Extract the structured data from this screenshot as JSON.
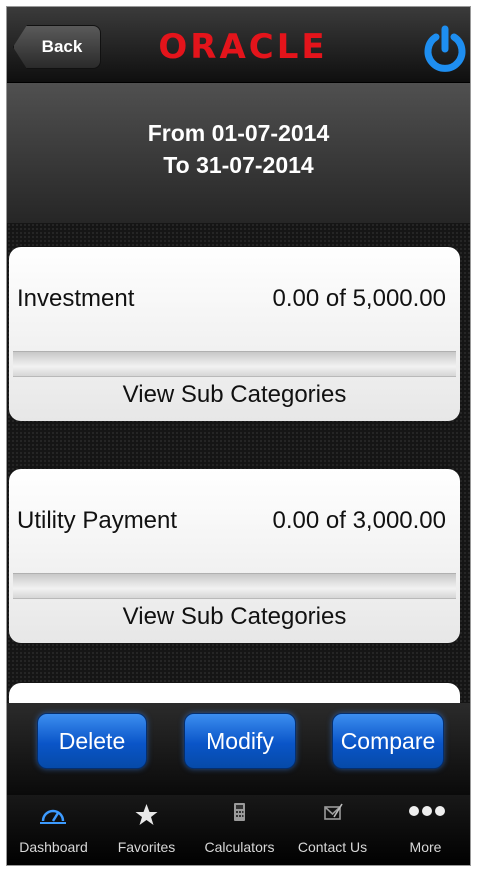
{
  "header": {
    "back_label": "Back",
    "logo_text": "ORACLE",
    "power_icon": "power-icon"
  },
  "period": {
    "from_text": "From 01-07-2014",
    "to_text": "To 31-07-2014"
  },
  "budgets": [
    {
      "name": "Investment",
      "amount_text": "0.00 of 5,000.00",
      "progress_fraction": 0,
      "link_label": "View Sub Categories"
    },
    {
      "name": "Utility Payment",
      "amount_text": "0.00 of 3,000.00",
      "progress_fraction": 0,
      "link_label": "View Sub Categories"
    }
  ],
  "actions": {
    "delete_label": "Delete",
    "modify_label": "Modify",
    "compare_label": "Compare"
  },
  "tabs": [
    {
      "label": "Dashboard",
      "icon": "dashboard-icon"
    },
    {
      "label": "Favorites",
      "icon": "star-icon"
    },
    {
      "label": "Calculators",
      "icon": "calculator-icon"
    },
    {
      "label": "Contact Us",
      "icon": "contact-icon"
    },
    {
      "label": "More",
      "icon": "more-icon"
    }
  ],
  "colors": {
    "brand_red": "#e4141b",
    "power_blue": "#1e8ef0",
    "button_blue": "#0a55c8"
  }
}
